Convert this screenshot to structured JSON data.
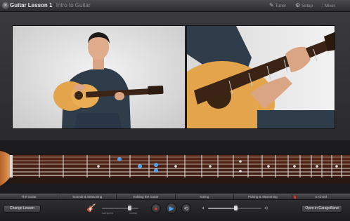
{
  "window": {
    "close_glyph": "×",
    "title": "Guitar Lesson 1",
    "subtitle": "Intro to Guitar"
  },
  "toolbar": {
    "tuner_label": "Tuner",
    "tuner_icon": "tuning-fork-icon",
    "setup_label": "Setup",
    "setup_icon": "gear-icon",
    "mixer_label": "Mixer",
    "mixer_icon": "sliders-icon"
  },
  "chapters": [
    {
      "label": "The Guitar",
      "active": false
    },
    {
      "label": "Sounds & Seasoning",
      "active": false
    },
    {
      "label": "Holding the Guitar",
      "active": false
    },
    {
      "label": "Tuning",
      "active": false
    },
    {
      "label": "Picking & Strumming",
      "active": false
    },
    {
      "label": "E Chord",
      "active": true
    }
  ],
  "controls": {
    "change_lesson_label": "Change Lesson",
    "open_garageband_label": "Open in GarageBand",
    "speed_labels": {
      "slow": "half speed",
      "normal": "normal"
    },
    "speed_level": 0.75,
    "volume_level": 0.52,
    "record_glyph": "●",
    "play_glyph": "▶",
    "loop_glyph": "⟲",
    "guitar_glyph": "🎸",
    "volume_low_glyph": "◂",
    "volume_high_glyph": "◂)"
  },
  "colors": {
    "accent_blue": "#4aa3ff",
    "record_red": "#e03a2a",
    "chapter_marker": "#cc3333"
  }
}
